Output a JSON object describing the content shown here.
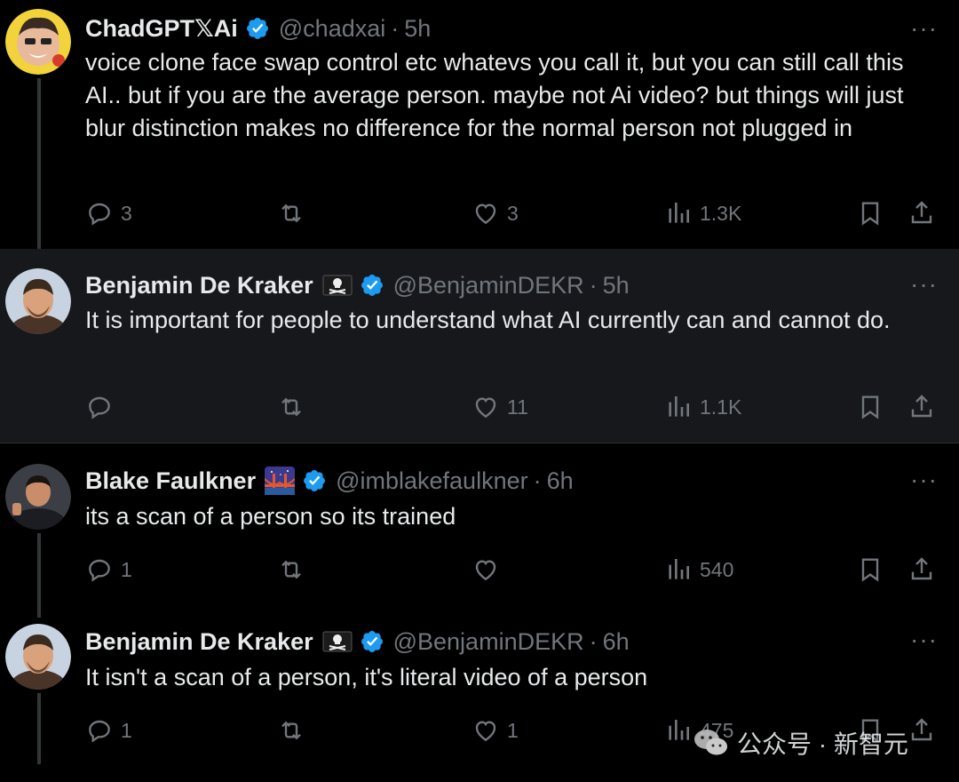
{
  "colors": {
    "background": "#000000",
    "highlight_background": "#16181c",
    "text_primary": "#e7e9ea",
    "text_secondary": "#71767b",
    "verified_blue": "#1d9bf0"
  },
  "tweets": [
    {
      "name": "ChadGPT𝕏Ai",
      "handle": "@chadxai",
      "separator": "·",
      "time": "5h",
      "badge_icon": "",
      "text": "voice clone face swap control etc  whatevs you call it, but you can still call this AI.. but if you are the average person. maybe not Ai video? but things will just blur distinction makes no difference for the normal person not plugged in",
      "replies": "3",
      "retweets": "",
      "likes": "3",
      "views": "1.3K"
    },
    {
      "name": "Benjamin De Kraker",
      "handle": "@BenjaminDEKR",
      "separator": "·",
      "time": "5h",
      "badge_icon": "skull-crossbones-flag-icon",
      "text": "It is important for people to understand what AI currently can and cannot do.",
      "replies": "",
      "retweets": "",
      "likes": "11",
      "views": "1.1K"
    },
    {
      "name": "Blake Faulkner",
      "handle": "@imblakefaulkner",
      "separator": "·",
      "time": "6h",
      "badge_icon": "bridge-at-night-icon",
      "text": "its a scan of a person so its trained",
      "replies": "1",
      "retweets": "",
      "likes": "",
      "views": "540"
    },
    {
      "name": "Benjamin De Kraker",
      "handle": "@BenjaminDEKR",
      "separator": "·",
      "time": "6h",
      "badge_icon": "skull-crossbones-flag-icon",
      "text": "It isn't a scan of a person, it's literal video of a person",
      "replies": "1",
      "retweets": "",
      "likes": "1",
      "views": "475"
    }
  ],
  "more_label": "···",
  "watermark": {
    "text": "公众号 · 新智元",
    "icon": "wechat-icon"
  }
}
